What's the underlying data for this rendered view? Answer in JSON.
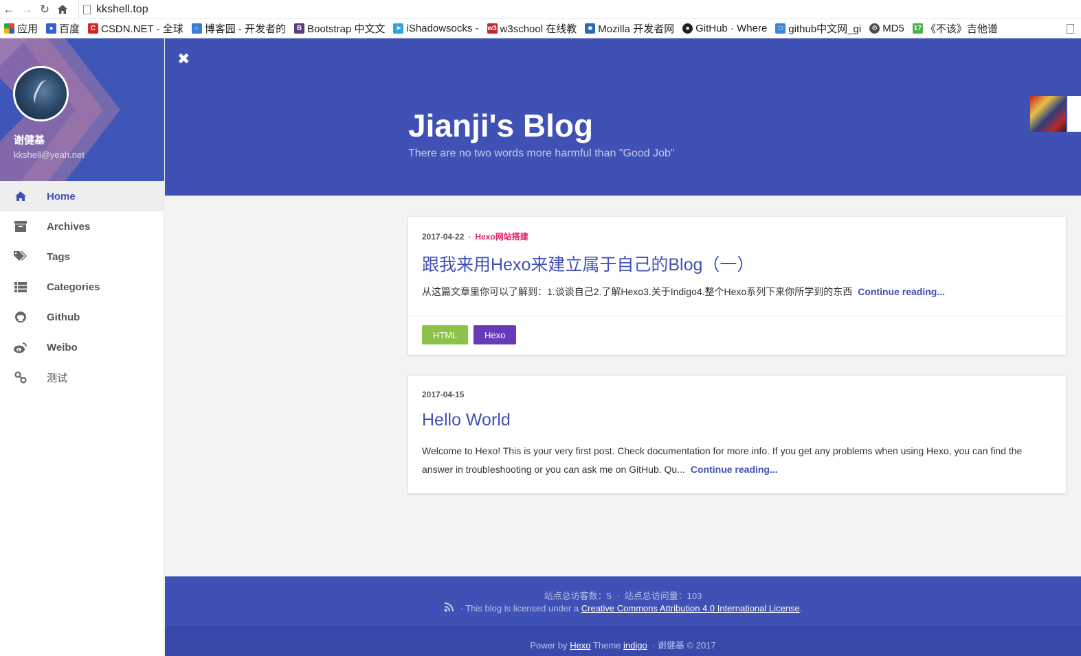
{
  "browser": {
    "url": "kkshell.top",
    "bookmarks": [
      {
        "label": "应用",
        "icon": "apps-grid-icon",
        "color": "#e0452f"
      },
      {
        "label": "百度",
        "icon": "baidu-paw-icon",
        "color": "#2f5fd7"
      },
      {
        "label": "CSDN.NET - 全球",
        "icon": "csdn-icon",
        "color": "#d62424"
      },
      {
        "label": "博客园 - 开发者的",
        "icon": "cnblogs-icon",
        "color": "#3a7bd5"
      },
      {
        "label": "Bootstrap 中文文",
        "icon": "bootstrap-icon",
        "color": "#563d7c"
      },
      {
        "label": "iShadowsocks -",
        "icon": "telegram-icon",
        "color": "#2ea6dd"
      },
      {
        "label": "w3school 在线教",
        "icon": "w3school-icon",
        "color": "#c0282e"
      },
      {
        "label": "Mozilla 开发者网",
        "icon": "mozilla-icon",
        "color": "#2a6bb8"
      },
      {
        "label": "GitHub · Where",
        "icon": "github-icon",
        "color": "#222222"
      },
      {
        "label": "github中文网_gi",
        "icon": "document-icon",
        "color": "#3a86d8"
      },
      {
        "label": "MD5",
        "icon": "md5-icon",
        "color": "#4c4c4c"
      },
      {
        "label": "《不该》吉他谱",
        "icon": "guitar-17-icon",
        "color": "#4caf50"
      }
    ]
  },
  "sidebar": {
    "name": "谢健基",
    "email": "kkshell@yeah.net",
    "items": [
      {
        "label": "Home",
        "icon": "home-icon",
        "active": true
      },
      {
        "label": "Archives",
        "icon": "archive-icon"
      },
      {
        "label": "Tags",
        "icon": "tags-icon"
      },
      {
        "label": "Categories",
        "icon": "list-icon"
      },
      {
        "label": "Github",
        "icon": "github-icon"
      },
      {
        "label": "Weibo",
        "icon": "weibo-icon"
      },
      {
        "label": "测试",
        "icon": "link-icon"
      }
    ]
  },
  "banner": {
    "title": "Jianji's Blog",
    "subtitle": "There are no two words more harmful than \"Good Job\""
  },
  "posts": [
    {
      "date": "2017-04-22",
      "separator": "·",
      "category": "Hexo网站搭建",
      "title": "跟我来用Hexo来建立属于自己的Blog（一）",
      "excerpt": "从这篇文章里你可以了解到：1.谈谈自己2.了解Hexo3.关于Indigo4.整个Hexo系列下来你所学到的东西",
      "continue": "Continue reading...",
      "tags": [
        "HTML",
        "Hexo"
      ]
    },
    {
      "date": "2017-04-15",
      "title": "Hello World",
      "excerpt": "Welcome to Hexo! This is your very first post. Check documentation for more info. If you get any problems when using Hexo, you can find the answer in troubleshooting or you can ask me on GitHub. Qu...",
      "continue": "Continue reading..."
    }
  ],
  "footer": {
    "visitors": "站点总访客数：5",
    "sep": "·",
    "pageviews": "站点总访问量：103",
    "license_prefix": "· This blog is licensed under a",
    "license_link": "Creative Commons Attribution 4.0 International License",
    "license_suffix": ".",
    "power_prefix": "Power by",
    "hexo_link": "Hexo",
    "theme_word": "Theme",
    "theme_link": "indigo",
    "copyright": "· 谢健基 © 2017"
  },
  "colors": {
    "primary": "#3f51b5",
    "accent": "#e91e63",
    "tag_html": "#8bc34a",
    "tag_hexo": "#673ab7"
  }
}
